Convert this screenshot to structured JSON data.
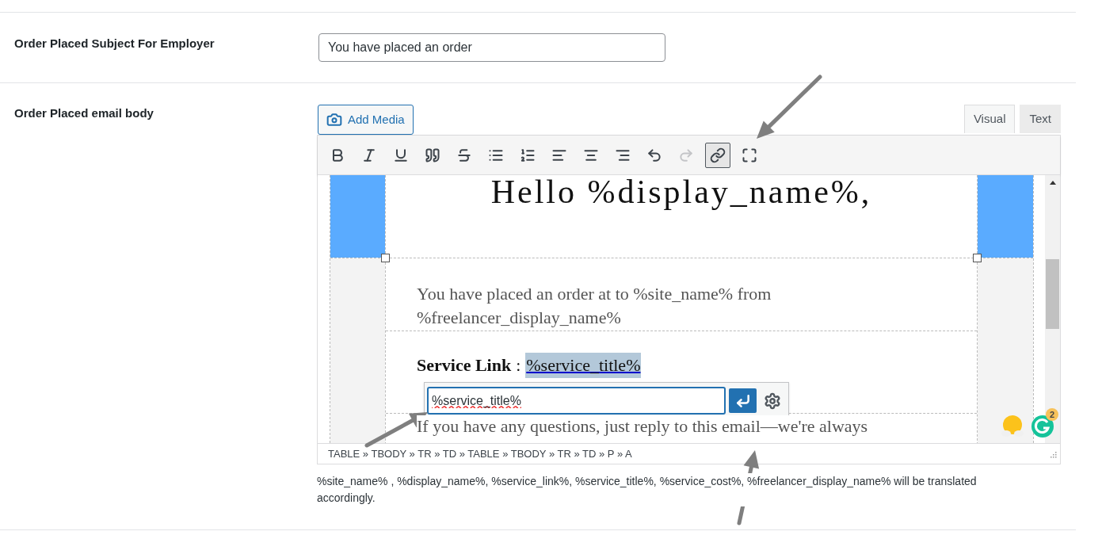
{
  "subject_field": {
    "label": "Order Placed Subject For Employer",
    "value": "You have placed an order"
  },
  "body_field": {
    "label": "Order Placed email body",
    "add_media": "Add Media",
    "tabs": [
      {
        "label": "Visual",
        "selected": true
      },
      {
        "label": "Text",
        "selected": false
      }
    ],
    "toolbar": [
      {
        "kind": "bold",
        "active": false,
        "disabled": false
      },
      {
        "kind": "italic",
        "active": false,
        "disabled": false
      },
      {
        "kind": "underline",
        "active": false,
        "disabled": false
      },
      {
        "kind": "blockquote",
        "active": false,
        "disabled": false
      },
      {
        "kind": "strikethrough",
        "active": false,
        "disabled": false
      },
      {
        "kind": "bullet-list",
        "active": false,
        "disabled": false
      },
      {
        "kind": "numbered-list",
        "active": false,
        "disabled": false
      },
      {
        "kind": "align-left",
        "active": false,
        "disabled": false
      },
      {
        "kind": "align-center",
        "active": false,
        "disabled": false
      },
      {
        "kind": "align-right",
        "active": false,
        "disabled": false
      },
      {
        "kind": "undo",
        "active": false,
        "disabled": false
      },
      {
        "kind": "redo",
        "active": false,
        "disabled": true
      },
      {
        "kind": "link",
        "active": true,
        "disabled": false
      },
      {
        "kind": "fullscreen",
        "active": false,
        "disabled": false
      }
    ],
    "content": {
      "heading": "Hello %display_name%,",
      "intro": "You have placed an order at to %site_name% from %freelancer_display_name%",
      "service_label": "Service Link",
      "separator": ":",
      "service_link": {
        "text": "%service_title%",
        "selected": true
      },
      "questions": "If you have any questions, just reply to this email—we're always"
    },
    "link_popup": {
      "value": "%service_title%"
    },
    "grammarly_count": "2",
    "status_path": "TABLE » TBODY » TR » TD » TABLE » TBODY » TR » TD » P » A",
    "help_text": "%site_name% , %display_name%, %service_link%, %service_title%, %service_cost%, %freelancer_display_name% will be translated accordingly."
  }
}
